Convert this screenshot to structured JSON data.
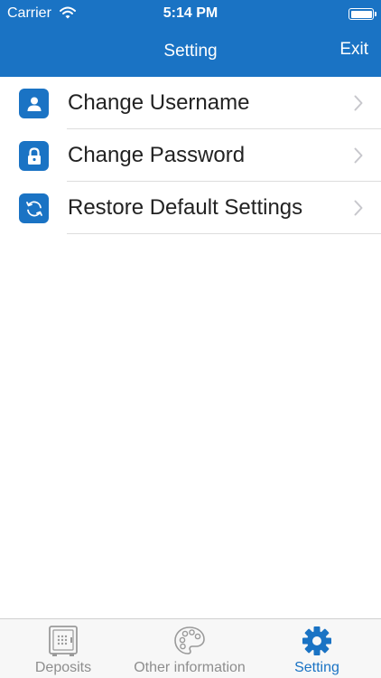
{
  "status_bar": {
    "carrier": "Carrier",
    "time": "5:14 PM"
  },
  "nav": {
    "title": "Setting",
    "exit_label": "Exit"
  },
  "settings": {
    "items": [
      {
        "label": "Change Username",
        "icon": "user-icon"
      },
      {
        "label": "Change Password",
        "icon": "lock-icon"
      },
      {
        "label": "Restore Default Settings",
        "icon": "refresh-icon"
      }
    ]
  },
  "tabbar": {
    "tabs": [
      {
        "label": "Deposits",
        "icon": "safe-icon"
      },
      {
        "label": "Other information",
        "icon": "palette-icon"
      },
      {
        "label": "Setting",
        "icon": "gear-icon",
        "active": true
      }
    ]
  },
  "colors": {
    "accent": "#1a73c4",
    "inactive": "#8e8e8e",
    "separator": "#dddddd"
  }
}
